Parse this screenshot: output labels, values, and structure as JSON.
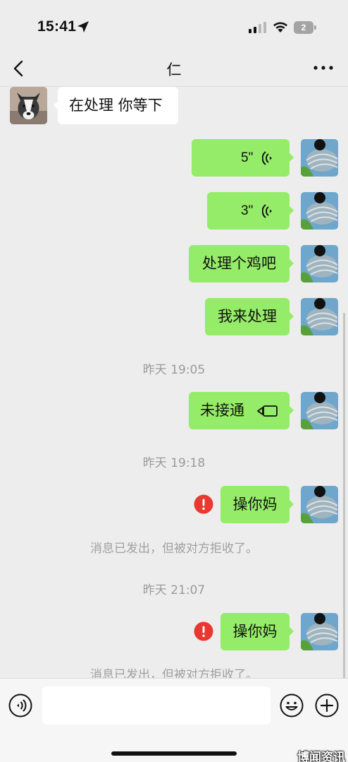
{
  "status_bar": {
    "time": "15:41",
    "battery": "2",
    "icons": [
      "location-arrow-icon",
      "cellular-signal-icon",
      "wifi-icon",
      "battery-icon"
    ]
  },
  "nav": {
    "title": "仁",
    "back_icon": "chevron-left-icon",
    "more_icon": "more-dots-icon"
  },
  "messages": [
    {
      "side": "in",
      "type": "text",
      "text": "在处理 你等下"
    },
    {
      "side": "out",
      "type": "voice",
      "duration": "5\""
    },
    {
      "side": "out",
      "type": "voice",
      "duration": "3\""
    },
    {
      "side": "out",
      "type": "text",
      "text": "处理个鸡吧"
    },
    {
      "side": "out",
      "type": "text",
      "text": "我来处理"
    },
    {
      "type": "timestamp",
      "text": "昨天 19:05"
    },
    {
      "side": "out",
      "type": "video_call",
      "text": "未接通"
    },
    {
      "type": "timestamp",
      "text": "昨天 19:18"
    },
    {
      "side": "out",
      "type": "text",
      "text": "操你妈",
      "failed": true
    },
    {
      "type": "system",
      "text": "消息已发出，但被对方拒收了。"
    },
    {
      "type": "timestamp",
      "text": "昨天 21:07"
    },
    {
      "side": "out",
      "type": "text",
      "text": "操你妈",
      "failed": true
    },
    {
      "type": "system",
      "text": "消息已发出，但被对方拒收了。"
    }
  ],
  "input_bar": {
    "placeholder": "",
    "icons": [
      "voice-toggle-icon",
      "emoji-icon",
      "plus-icon"
    ]
  },
  "watermark": "博闻资讯",
  "colors": {
    "background": "#ededed",
    "outgoing_bubble": "#95ec69",
    "incoming_bubble": "#ffffff",
    "error": "#e8382f"
  }
}
